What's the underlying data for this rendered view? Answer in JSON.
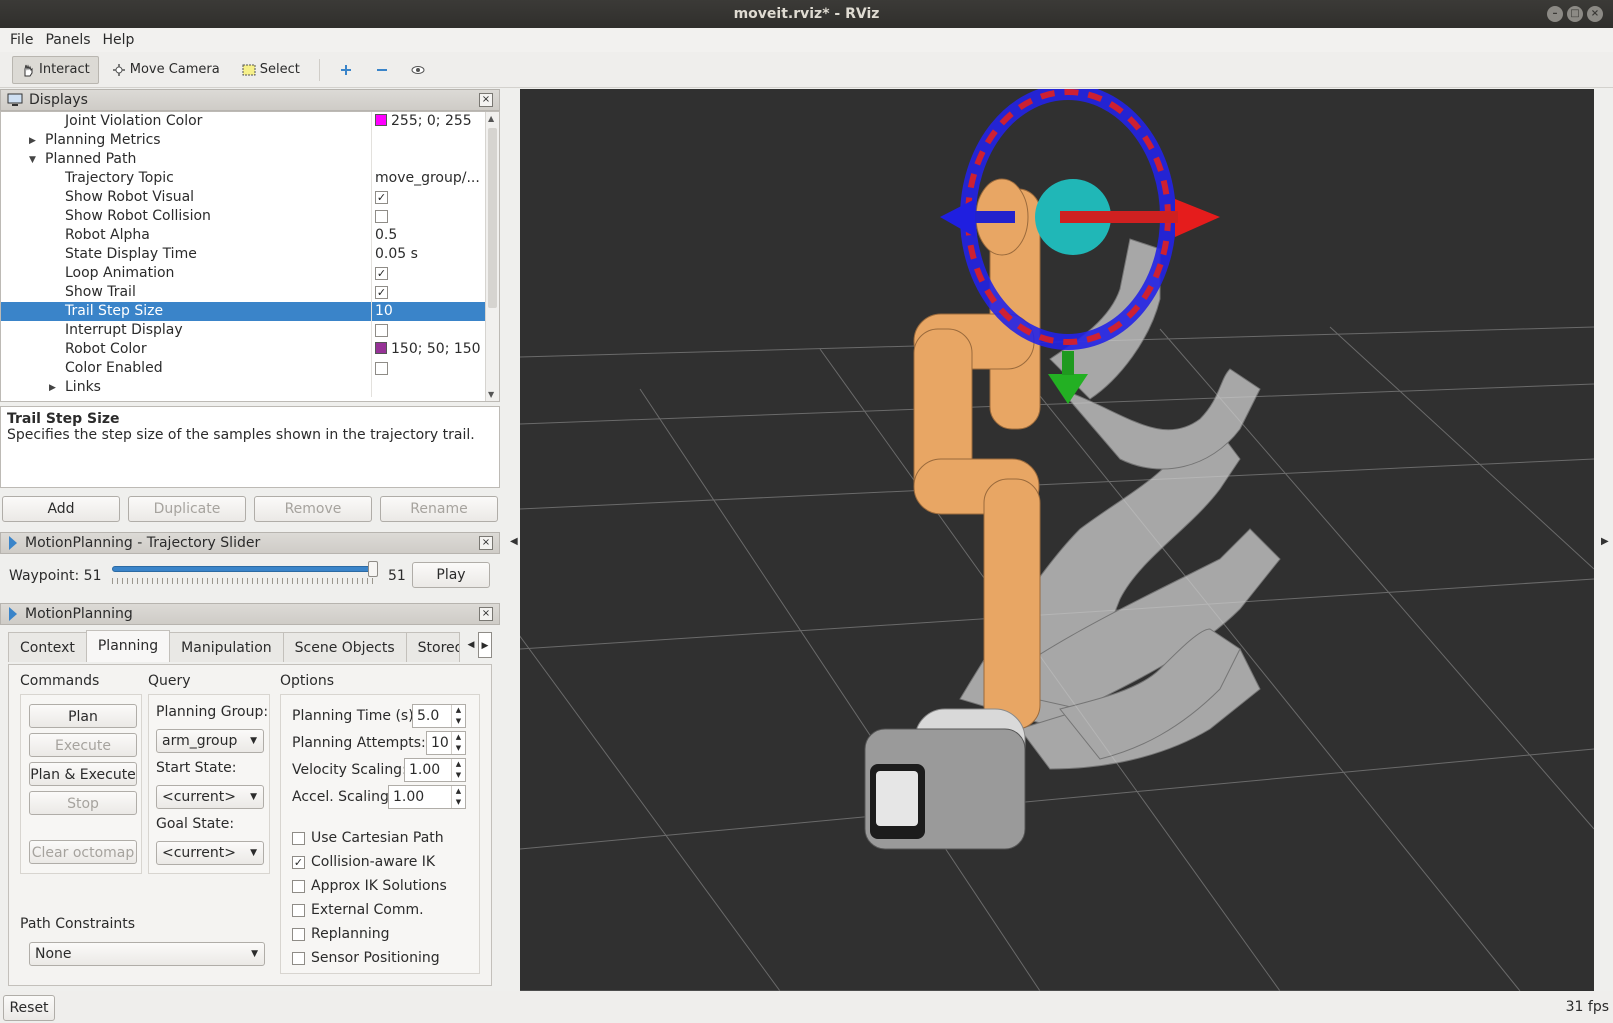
{
  "window": {
    "title": "moveit.rviz* - RViz"
  },
  "menu": [
    "File",
    "Panels",
    "Help"
  ],
  "toolbar": {
    "interact": "Interact",
    "move_camera": "Move Camera",
    "select": "Select"
  },
  "displays": {
    "title": "Displays",
    "rows": [
      {
        "name": "Joint Violation Color",
        "value": "255; 0; 255",
        "type": "color",
        "color": "#ff00ff",
        "indent": 2
      },
      {
        "name": "Planning Metrics",
        "type": "group-collapsed",
        "indent": 1
      },
      {
        "name": "Planned Path",
        "type": "group-expanded",
        "indent": 1
      },
      {
        "name": "Trajectory Topic",
        "value": "move_group/...",
        "type": "text",
        "indent": 2
      },
      {
        "name": "Show Robot Visual",
        "type": "check",
        "checked": true,
        "indent": 2
      },
      {
        "name": "Show Robot Collision",
        "type": "check",
        "checked": false,
        "indent": 2
      },
      {
        "name": "Robot Alpha",
        "value": "0.5",
        "type": "text",
        "indent": 2
      },
      {
        "name": "State Display Time",
        "value": "0.05 s",
        "type": "text",
        "indent": 2
      },
      {
        "name": "Loop Animation",
        "type": "check",
        "checked": true,
        "indent": 2
      },
      {
        "name": "Show Trail",
        "type": "check",
        "checked": true,
        "indent": 2
      },
      {
        "name": "Trail Step Size",
        "value": "10",
        "type": "text",
        "selected": true,
        "indent": 2
      },
      {
        "name": "Interrupt Display",
        "type": "check",
        "checked": false,
        "indent": 2
      },
      {
        "name": "Robot Color",
        "value": "150; 50; 150",
        "type": "color",
        "color": "#963296",
        "indent": 2
      },
      {
        "name": "Color Enabled",
        "type": "check",
        "checked": false,
        "indent": 2
      },
      {
        "name": "Links",
        "type": "group-collapsed",
        "indent": 2
      }
    ]
  },
  "description": {
    "title": "Trail Step Size",
    "text": "Specifies the step size of the samples shown in the trajectory trail."
  },
  "display_buttons": {
    "add": "Add",
    "duplicate": "Duplicate",
    "remove": "Remove",
    "rename": "Rename"
  },
  "slider_panel": {
    "title": "MotionPlanning - Trajectory Slider",
    "label": "Waypoint:  51",
    "value": "51",
    "position_fraction": 1.0,
    "play": "Play"
  },
  "motion_planning": {
    "title": "MotionPlanning",
    "tabs": [
      "Context",
      "Planning",
      "Manipulation",
      "Scene Objects",
      "Stored"
    ],
    "active_tab": "Planning",
    "commands": {
      "title": "Commands",
      "plan": "Plan",
      "execute": "Execute",
      "plan_execute": "Plan & Execute",
      "stop": "Stop",
      "clear_octomap": "Clear octomap"
    },
    "query": {
      "title": "Query",
      "planning_group_label": "Planning Group:",
      "planning_group": "arm_group",
      "start_state_label": "Start State:",
      "start_state": "<current>",
      "goal_state_label": "Goal State:",
      "goal_state": "<current>"
    },
    "options": {
      "title": "Options",
      "planning_time_label": "Planning Time (s):",
      "planning_time": "5.0",
      "planning_attempts_label": "Planning Attempts:",
      "planning_attempts": "10",
      "velocity_scaling_label": "Velocity Scaling:",
      "velocity_scaling": "1.00",
      "accel_scaling_label": "Accel. Scaling:",
      "accel_scaling": "1.00",
      "checks": [
        {
          "label": "Use Cartesian Path",
          "checked": false
        },
        {
          "label": "Collision-aware IK",
          "checked": true
        },
        {
          "label": "Approx IK Solutions",
          "checked": false
        },
        {
          "label": "External Comm.",
          "checked": false
        },
        {
          "label": "Replanning",
          "checked": false
        },
        {
          "label": "Sensor Positioning",
          "checked": false
        }
      ]
    },
    "path_constraints": {
      "label": "Path Constraints",
      "value": "None"
    }
  },
  "status": {
    "reset": "Reset",
    "fps": "31 fps"
  },
  "colors": {
    "selection": "#3a84c9",
    "viewport_bg": "#303030",
    "arm_orange": "#e8a664"
  }
}
